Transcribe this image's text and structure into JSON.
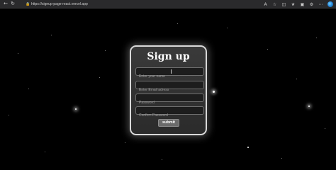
{
  "browser": {
    "url": "https://signup-page-react.vercel.app"
  },
  "form": {
    "title": "Sign up",
    "fields": {
      "name_placeholder": "Enter your name",
      "email_placeholder": "Enter Email adress",
      "password_placeholder": "Password",
      "confirm_placeholder": "Confirm Password"
    },
    "submit_label": "submit"
  },
  "colors": {
    "background": "#000000",
    "card_border": "#d9d9d9",
    "card_fill": "#333333",
    "button_fill": "#6b6b6b"
  }
}
